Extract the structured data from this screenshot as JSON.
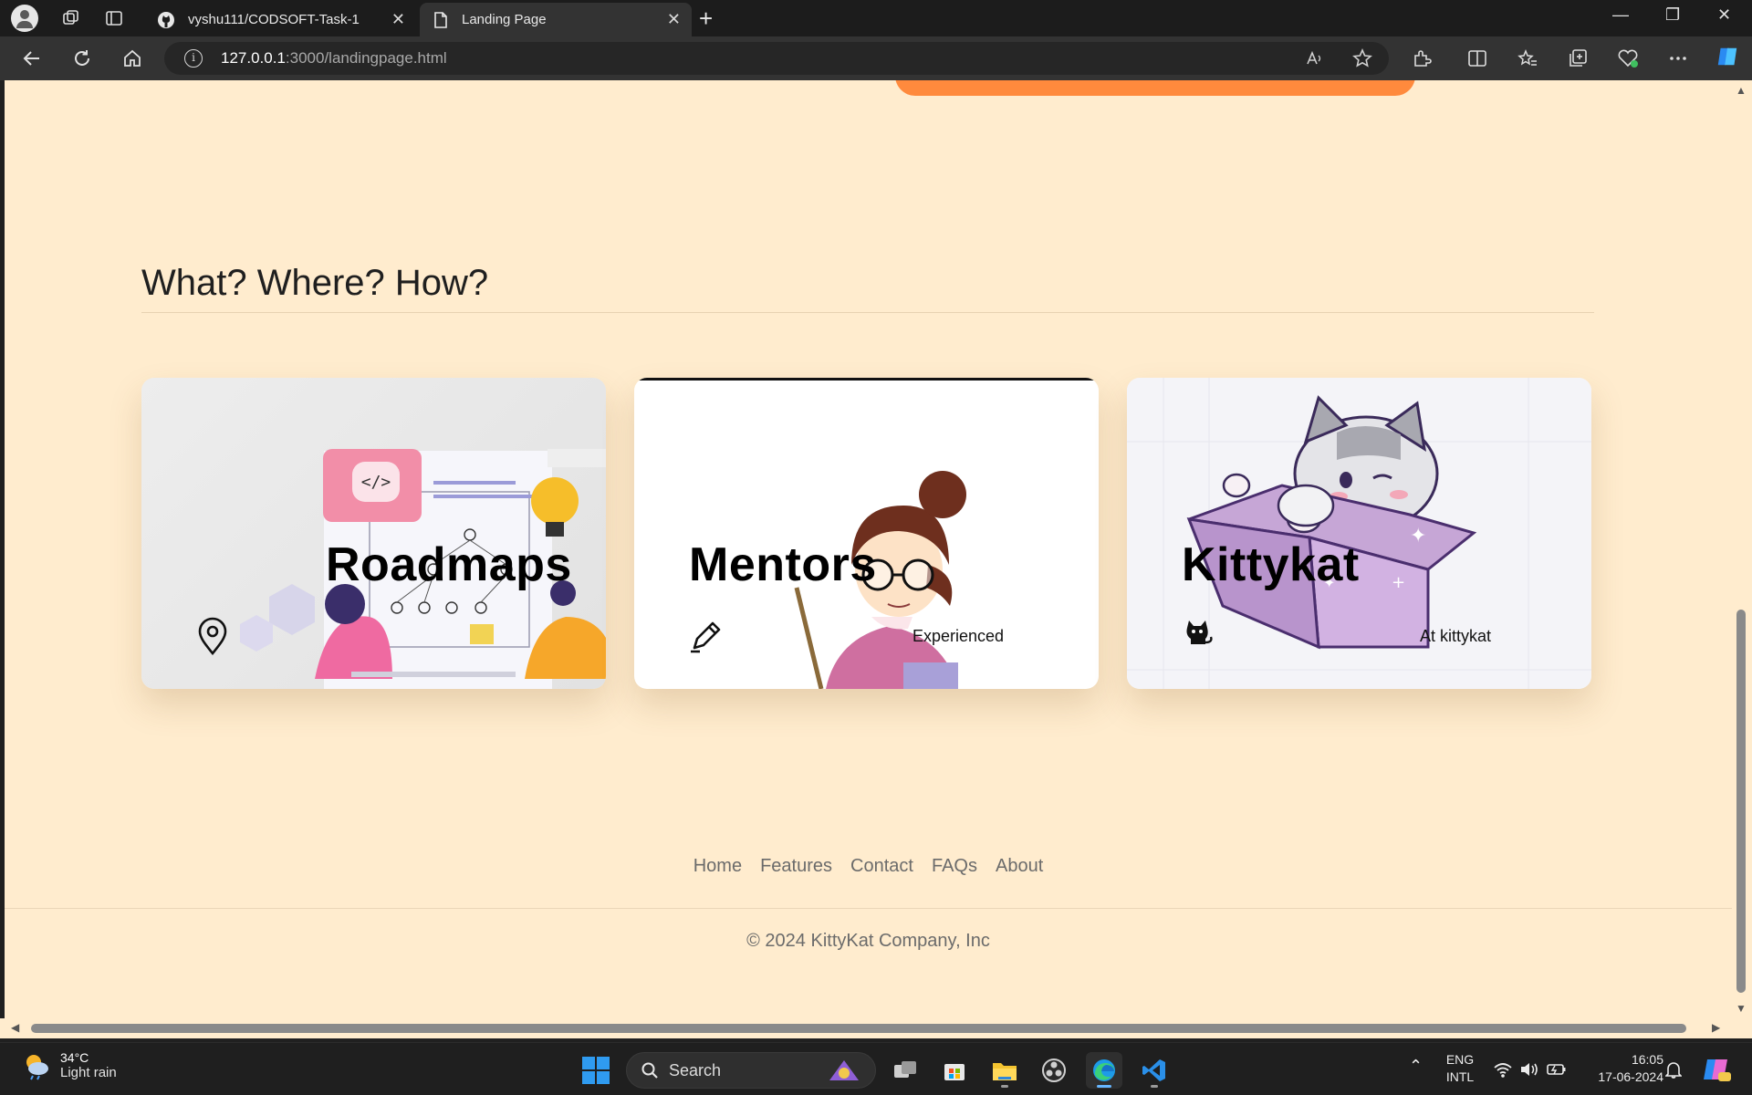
{
  "browser": {
    "tabs": [
      {
        "title": "vyshu111/CODSOFT-Task-1",
        "icon": "github-icon",
        "active": false
      },
      {
        "title": "Landing Page",
        "icon": "page-icon",
        "active": true
      }
    ],
    "address": {
      "host": "127.0.0.1",
      "rest": ":3000/landingpage.html"
    }
  },
  "page": {
    "section_heading": "What? Where? How?",
    "cards": [
      {
        "title": "Roadmaps",
        "caption": "",
        "icon": "map-pin-icon"
      },
      {
        "title": "Mentors",
        "caption": "Experienced",
        "icon": "pencil-icon"
      },
      {
        "title": "Kittykat",
        "caption": "At kittykat",
        "icon": "cat-icon"
      }
    ],
    "footer_nav": [
      "Home",
      "Features",
      "Contact",
      "FAQs",
      "About"
    ],
    "copyright": "© 2024 KittyKat Company, Inc"
  },
  "taskbar": {
    "weather": {
      "temp": "34°C",
      "condition": "Light rain"
    },
    "search_placeholder": "Search",
    "language": {
      "line1": "ENG",
      "line2": "INTL"
    },
    "clock": {
      "time": "16:05",
      "date": "17-06-2024"
    }
  },
  "colors": {
    "page_bg": "#ffecce",
    "accent_orange": "#ff8a3d",
    "chrome_dark": "#1c1c1c"
  }
}
